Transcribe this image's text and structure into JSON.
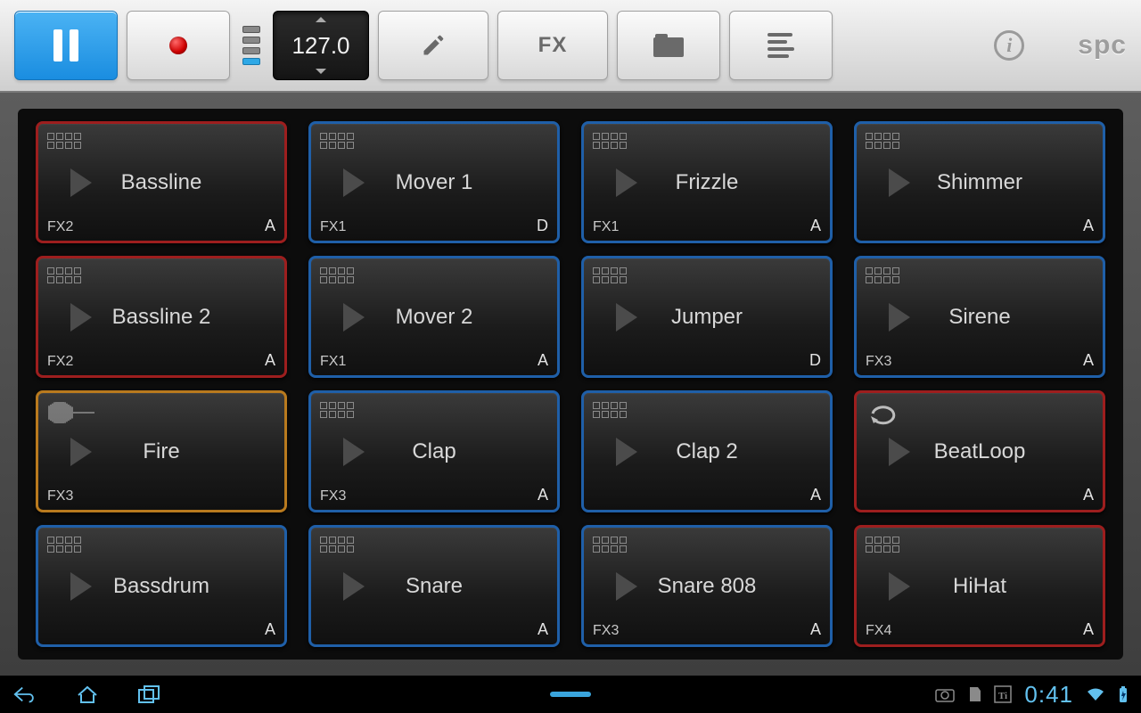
{
  "toolbar": {
    "tempo": "127.0",
    "fx_label": "FX",
    "brand": "spc"
  },
  "pads": [
    {
      "name": "Bassline",
      "fx": "FX2",
      "group": "A",
      "color": "red",
      "mode": "cells"
    },
    {
      "name": "Mover 1",
      "fx": "FX1",
      "group": "D",
      "color": "blue",
      "mode": "cells"
    },
    {
      "name": "Frizzle",
      "fx": "FX1",
      "group": "A",
      "color": "blue",
      "mode": "cells"
    },
    {
      "name": "Shimmer",
      "fx": "",
      "group": "A",
      "color": "blue",
      "mode": "cells"
    },
    {
      "name": "Bassline 2",
      "fx": "FX2",
      "group": "A",
      "color": "red",
      "mode": "cells"
    },
    {
      "name": "Mover 2",
      "fx": "FX1",
      "group": "A",
      "color": "blue",
      "mode": "cells"
    },
    {
      "name": "Jumper",
      "fx": "",
      "group": "D",
      "color": "blue",
      "mode": "cells"
    },
    {
      "name": "Sirene",
      "fx": "FX3",
      "group": "A",
      "color": "blue",
      "mode": "cells"
    },
    {
      "name": "Fire",
      "fx": "FX3",
      "group": "",
      "color": "orange",
      "mode": "wave"
    },
    {
      "name": "Clap",
      "fx": "FX3",
      "group": "A",
      "color": "blue",
      "mode": "cells"
    },
    {
      "name": "Clap 2",
      "fx": "",
      "group": "A",
      "color": "blue",
      "mode": "cells"
    },
    {
      "name": "BeatLoop",
      "fx": "",
      "group": "A",
      "color": "red",
      "mode": "loop"
    },
    {
      "name": "Bassdrum",
      "fx": "",
      "group": "A",
      "color": "blue",
      "mode": "cells"
    },
    {
      "name": "Snare",
      "fx": "",
      "group": "A",
      "color": "blue",
      "mode": "cells"
    },
    {
      "name": "Snare 808",
      "fx": "FX3",
      "group": "A",
      "color": "blue",
      "mode": "cells"
    },
    {
      "name": "HiHat",
      "fx": "FX4",
      "group": "A",
      "color": "red",
      "mode": "cells"
    }
  ],
  "status": {
    "clock": "0:41"
  }
}
